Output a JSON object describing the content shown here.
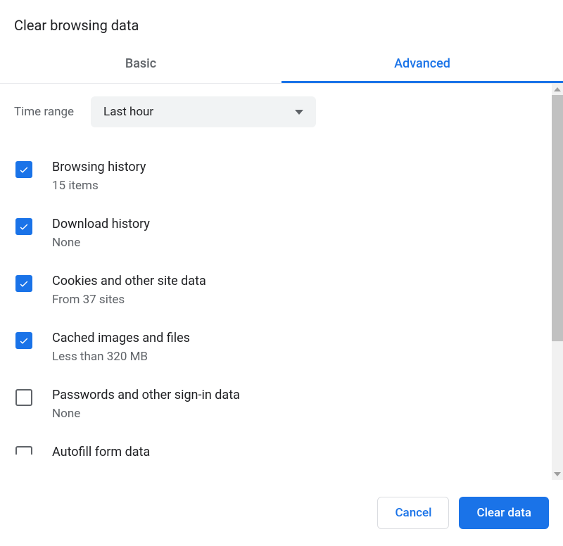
{
  "dialog": {
    "title": "Clear browsing data",
    "tabs": {
      "basic": "Basic",
      "advanced": "Advanced",
      "active": "advanced"
    },
    "time_range": {
      "label": "Time range",
      "selected": "Last hour"
    },
    "options": [
      {
        "title": "Browsing history",
        "subtitle": "15 items",
        "checked": true
      },
      {
        "title": "Download history",
        "subtitle": "None",
        "checked": true
      },
      {
        "title": "Cookies and other site data",
        "subtitle": "From 37 sites",
        "checked": true
      },
      {
        "title": "Cached images and files",
        "subtitle": "Less than 320 MB",
        "checked": true
      },
      {
        "title": "Passwords and other sign-in data",
        "subtitle": "None",
        "checked": false
      },
      {
        "title": "Autofill form data",
        "subtitle": "",
        "checked": false
      }
    ],
    "footer": {
      "cancel": "Cancel",
      "clear": "Clear data"
    }
  }
}
